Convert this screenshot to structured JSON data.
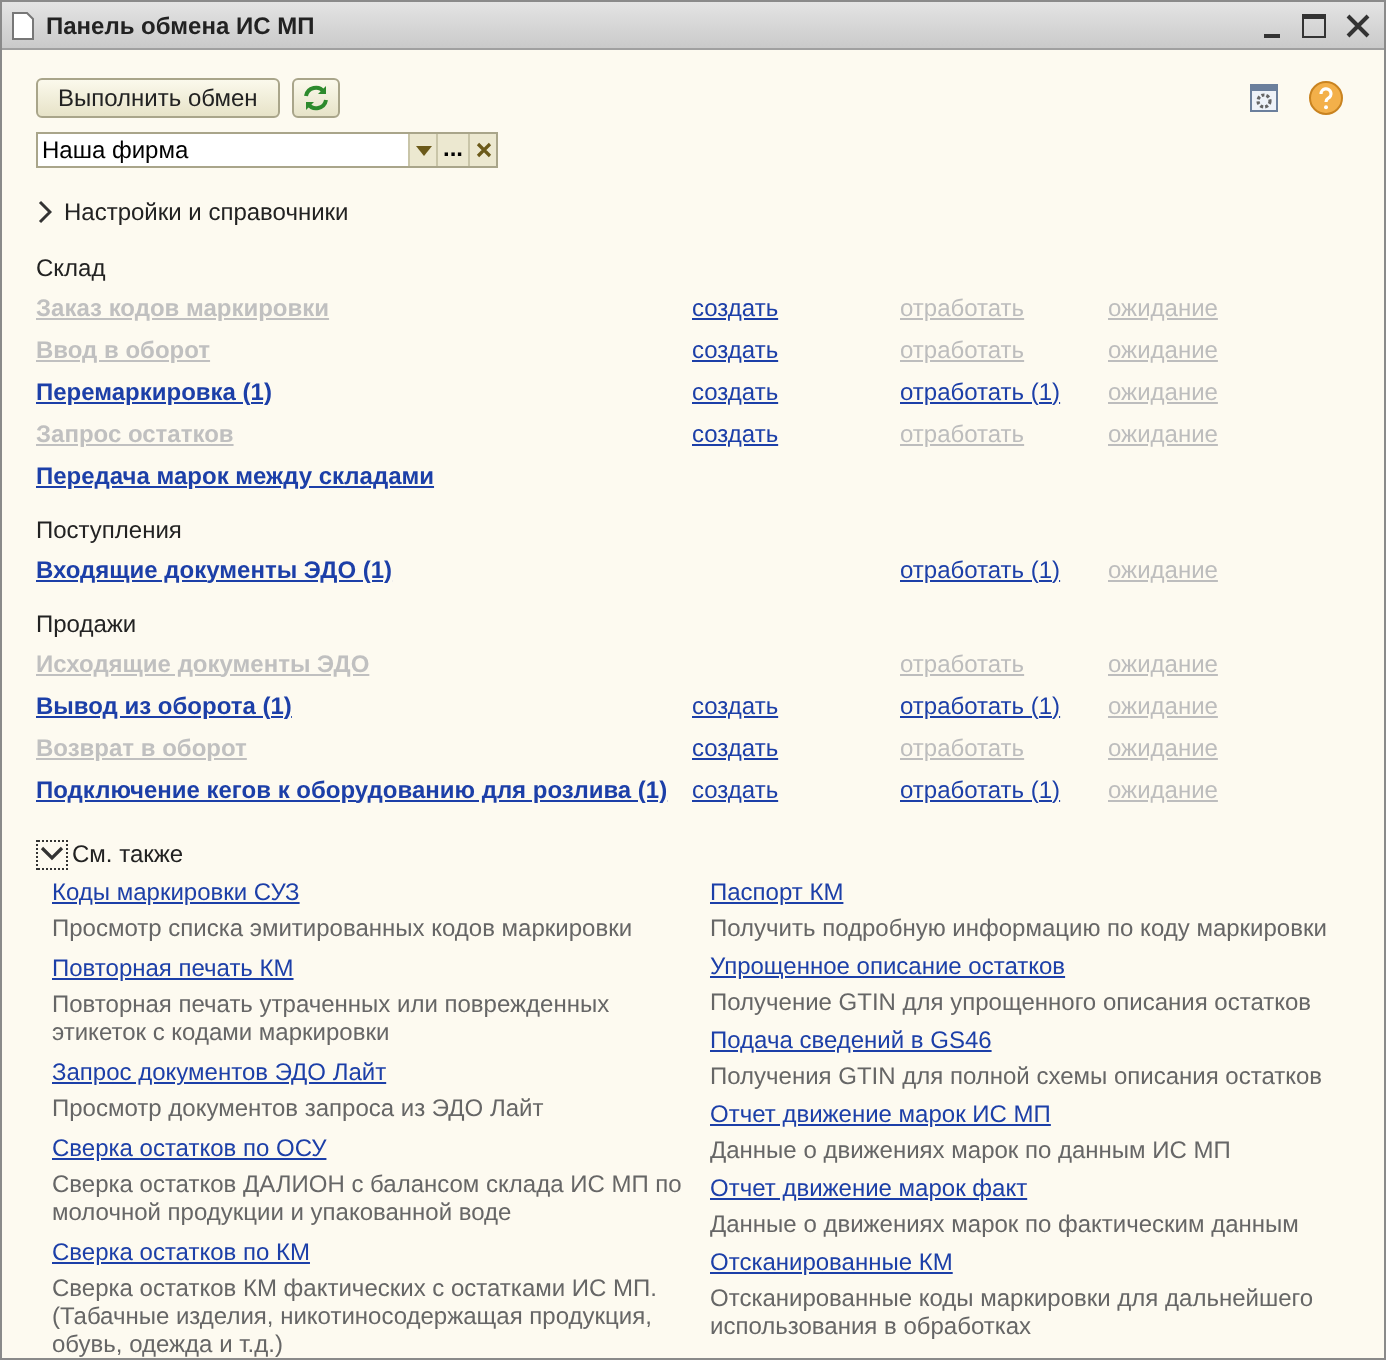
{
  "window": {
    "title": "Панель обмена ИС МП"
  },
  "toolbar": {
    "run_button": "Выполнить обмен"
  },
  "organization_field": {
    "value": "Наша фирма",
    "choose_button": "..."
  },
  "settings_group": {
    "label": "Настройки и справочники",
    "expanded": false
  },
  "sections": [
    {
      "title": "Склад",
      "rows": [
        {
          "name": "Заказ кодов маркировки",
          "disabled": true,
          "create": {
            "text": "создать",
            "disabled": false
          },
          "process": {
            "text": "отработать",
            "disabled": true
          },
          "wait": {
            "text": "ожидание",
            "disabled": true
          }
        },
        {
          "name": "Ввод в оборот",
          "disabled": true,
          "create": {
            "text": "создать",
            "disabled": false
          },
          "process": {
            "text": "отработать",
            "disabled": true
          },
          "wait": {
            "text": "ожидание",
            "disabled": true
          }
        },
        {
          "name": "Перемаркировка (1)",
          "disabled": false,
          "create": {
            "text": "создать",
            "disabled": false
          },
          "process": {
            "text": "отработать (1)",
            "disabled": false
          },
          "wait": {
            "text": "ожидание",
            "disabled": true
          }
        },
        {
          "name": "Запрос остатков",
          "disabled": true,
          "create": {
            "text": "создать",
            "disabled": false
          },
          "process": {
            "text": "отработать",
            "disabled": true
          },
          "wait": {
            "text": "ожидание",
            "disabled": true
          }
        },
        {
          "name": "Передача марок между складами",
          "disabled": false
        }
      ]
    },
    {
      "title": "Поступления",
      "rows": [
        {
          "name": "Входящие документы ЭДО (1)",
          "disabled": false,
          "process": {
            "text": "отработать (1)",
            "disabled": false
          },
          "wait": {
            "text": "ожидание",
            "disabled": true
          }
        }
      ]
    },
    {
      "title": "Продажи",
      "rows": [
        {
          "name": "Исходящие документы ЭДО",
          "disabled": true,
          "process": {
            "text": "отработать",
            "disabled": true
          },
          "wait": {
            "text": "ожидание",
            "disabled": true
          }
        },
        {
          "name": "Вывод из оборота (1)",
          "disabled": false,
          "create": {
            "text": "создать",
            "disabled": false
          },
          "process": {
            "text": "отработать (1)",
            "disabled": false
          },
          "wait": {
            "text": "ожидание",
            "disabled": true
          }
        },
        {
          "name": "Возврат в оборот",
          "disabled": true,
          "create": {
            "text": "создать",
            "disabled": false
          },
          "process": {
            "text": "отработать",
            "disabled": true
          },
          "wait": {
            "text": "ожидание",
            "disabled": true
          }
        },
        {
          "name": "Подключение кегов к оборудованию для розлива (1)",
          "disabled": false,
          "create": {
            "text": "создать",
            "disabled": false
          },
          "process": {
            "text": "отработать (1)",
            "disabled": false
          },
          "wait": {
            "text": "ожидание",
            "disabled": true
          }
        }
      ]
    }
  ],
  "see_also": {
    "label": "См. также",
    "expanded": true,
    "columns": [
      [
        {
          "title": "Коды маркировки СУЗ",
          "description": "Просмотр списка эмитированных кодов маркировки"
        },
        {
          "title": "Повторная печать КМ",
          "description": "Повторная печать утраченных или поврежденных этикеток с кодами маркировки"
        },
        {
          "title": "Запрос документов ЭДО Лайт",
          "description": "Просмотр документов запроса из ЭДО Лайт"
        },
        {
          "title": "Сверка остатков по ОСУ",
          "description": "Сверка остатков ДАЛИОН с балансом склада ИС МП по молочной продукции и упакованной воде"
        },
        {
          "title": "Сверка остатков по КМ",
          "description": "Сверка остатков КМ фактических с остатками ИС МП. (Табачные изделия, никотиносодержащая продукция, обувь, одежда и т.д.)"
        }
      ],
      [
        {
          "title": "Паспорт КМ",
          "description": "Получить подробную информацию по коду маркировки"
        },
        {
          "title": "Упрощенное описание остатков",
          "description": "Получение GTIN для упрощенного описания остатков"
        },
        {
          "title": "Подача сведений в GS46",
          "description": "Получения GTIN для полной схемы описания остатков"
        },
        {
          "title": "Отчет движение марок ИС МП",
          "description": "Данные о движениях марок по данным ИС МП"
        },
        {
          "title": "Отчет движение марок факт",
          "description": "Данные о движениях марок по фактическим данным"
        },
        {
          "title": "Отсканированные КМ",
          "description": "Отсканированные коды маркировки для дальнейшего использования в обработках"
        }
      ]
    ]
  }
}
